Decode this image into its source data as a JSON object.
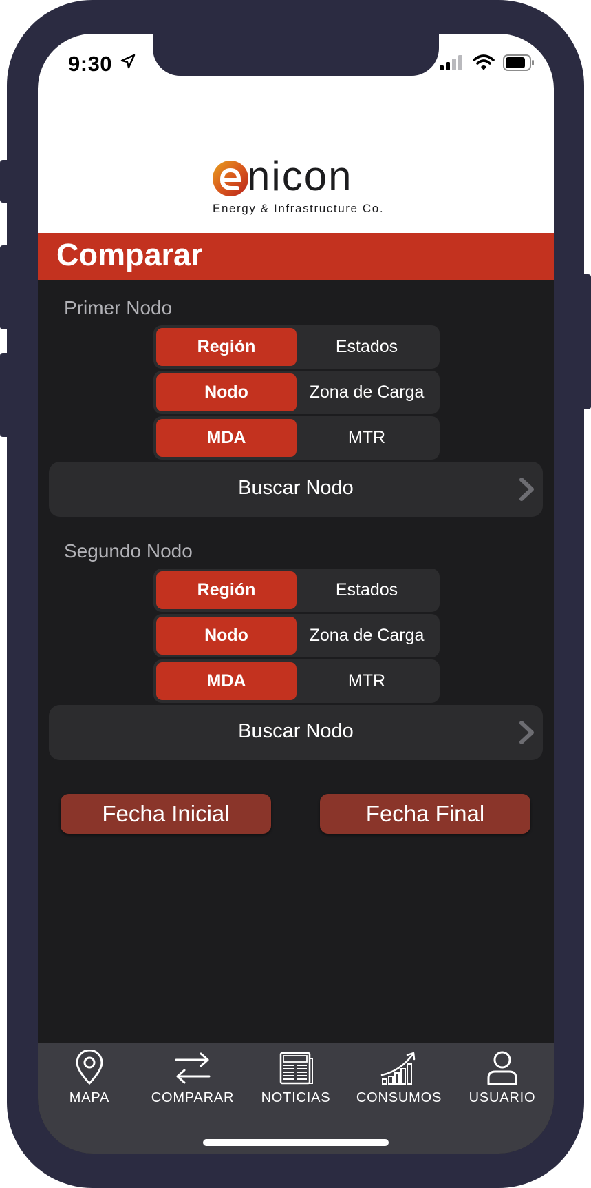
{
  "status_bar": {
    "time": "9:30",
    "location_icon": "location-arrow-icon",
    "signal_icon": "cellular-signal-icon",
    "wifi_icon": "wifi-icon",
    "battery_icon": "battery-icon"
  },
  "logo": {
    "word": "nicon",
    "tagline": "Energy & Infrastructure Co.",
    "mark_icon": "enicon-e-logo-icon"
  },
  "page": {
    "title": "Comparar"
  },
  "first_node": {
    "label": "Primer Nodo",
    "segments": [
      {
        "options": [
          "Región",
          "Estados"
        ],
        "selected": 0
      },
      {
        "options": [
          "Nodo",
          "Zona de Carga"
        ],
        "selected": 0
      },
      {
        "options": [
          "MDA",
          "MTR"
        ],
        "selected": 0
      }
    ],
    "search_label": "Buscar Nodo"
  },
  "second_node": {
    "label": "Segundo Nodo",
    "segments": [
      {
        "options": [
          "Región",
          "Estados"
        ],
        "selected": 0
      },
      {
        "options": [
          "Nodo",
          "Zona de Carga"
        ],
        "selected": 0
      },
      {
        "options": [
          "MDA",
          "MTR"
        ],
        "selected": 0
      }
    ],
    "search_label": "Buscar Nodo"
  },
  "dates": {
    "start_label": "Fecha Inicial",
    "end_label": "Fecha Final"
  },
  "tabbar": {
    "items": [
      {
        "label": "MAPA",
        "icon": "map-pin-icon"
      },
      {
        "label": "COMPARAR",
        "icon": "compare-arrows-icon",
        "active": true
      },
      {
        "label": "NOTICIAS",
        "icon": "newspaper-icon"
      },
      {
        "label": "CONSUMOS",
        "icon": "growth-chart-icon"
      },
      {
        "label": "USUARIO",
        "icon": "user-icon"
      }
    ]
  },
  "colors": {
    "accent": "#c3321f",
    "date_button": "#8a352a",
    "background": "#1c1c1e",
    "control": "#2c2c2e",
    "tabbar": "#3d3d43",
    "frame": "#2b2b41"
  }
}
